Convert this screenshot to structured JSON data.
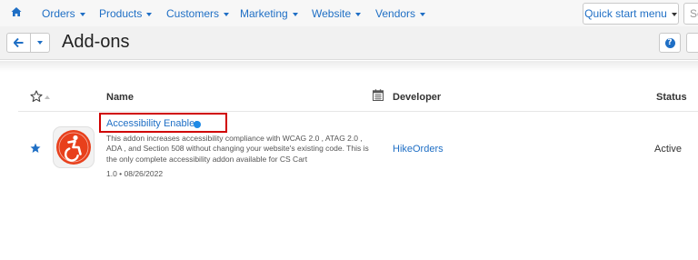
{
  "nav": {
    "items": [
      {
        "label": "Orders"
      },
      {
        "label": "Products"
      },
      {
        "label": "Customers"
      },
      {
        "label": "Marketing"
      },
      {
        "label": "Website"
      },
      {
        "label": "Vendors"
      }
    ],
    "quick_start_label": "Quick start menu",
    "search_placeholder": "Se"
  },
  "header": {
    "title": "Add-ons"
  },
  "table": {
    "columns": {
      "name": "Name",
      "developer": "Developer",
      "status": "Status"
    },
    "rows": [
      {
        "name": "Accessibility Enabler",
        "description": "This addon increases accessibility compliance with WCAG 2.0 , ATAG 2.0 , ADA , and Section 508 without changing your website's existing code. This is the only complete accessibility addon available for CS Cart",
        "meta": "1.0 • 08/26/2022",
        "developer": "HikeOrders",
        "status": "Active"
      }
    ]
  },
  "colors": {
    "link": "#1f6fc5",
    "highlight_border": "#d00000",
    "logo_orange": "#e8401c",
    "new_dot": "#1f8ae6"
  },
  "icons": [
    "home-icon",
    "arrow-left-icon",
    "chevron-down-icon",
    "help-icon",
    "star-outline-icon",
    "calendar-icon",
    "star-icon",
    "accessibility-icon"
  ]
}
